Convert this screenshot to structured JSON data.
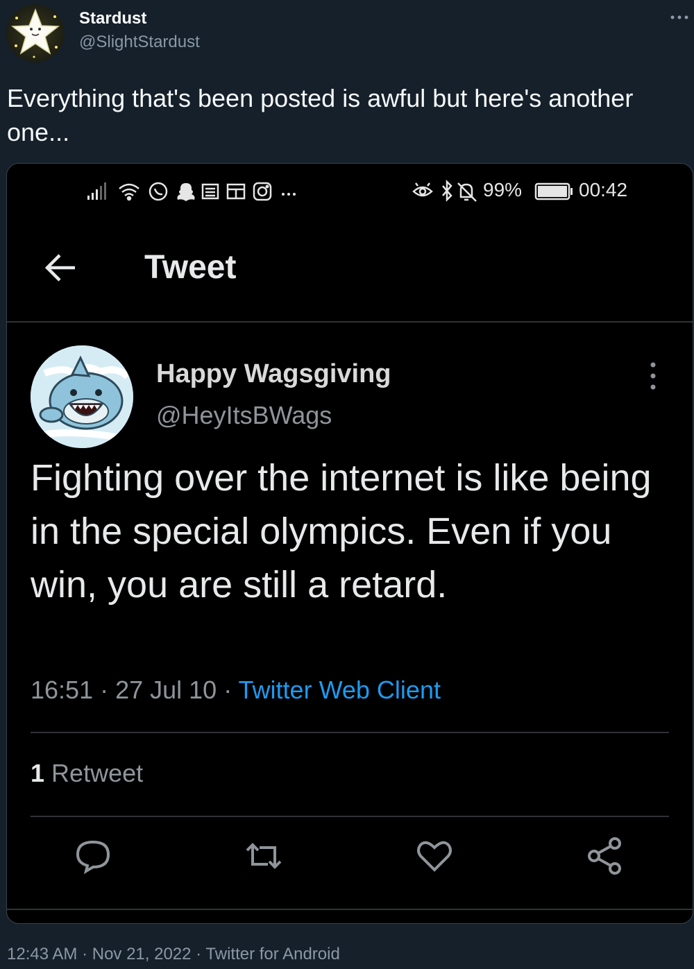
{
  "outer_tweet": {
    "author_name": "Stardust",
    "author_handle": "@SlightStardust",
    "text": "Everything that's been posted is awful but here's another one...",
    "timestamp": "12:43 AM · Nov 21, 2022 · Twitter for Android",
    "avatar_icon": "star-avatar-icon",
    "more_icon": "more-horizontal-icon"
  },
  "screenshot": {
    "status_bar": {
      "left_icons": [
        "signal-icon",
        "wifi-icon",
        "whatsapp-icon",
        "snapchat-icon",
        "news-icon",
        "calendar-icon",
        "instagram-icon",
        "more-dots-icon"
      ],
      "battery": "99%",
      "time": "00:42"
    },
    "app_bar": {
      "title": "Tweet",
      "back_icon": "arrow-left-icon"
    },
    "tweet": {
      "author_name": "Happy Wagsgiving",
      "author_handle": "@HeyItsBWags",
      "text": "Fighting over the internet is like being in the special olympics. Even if you win, you are still a retard.",
      "time": "16:51",
      "date": "27 Jul 10",
      "client": "Twitter Web Client",
      "separator": " · ",
      "retweet_count": "1",
      "retweet_label": "Retweet"
    },
    "colors": {
      "link": "#1d9bf0",
      "background": "#000000",
      "outer_background": "#15202b"
    }
  }
}
